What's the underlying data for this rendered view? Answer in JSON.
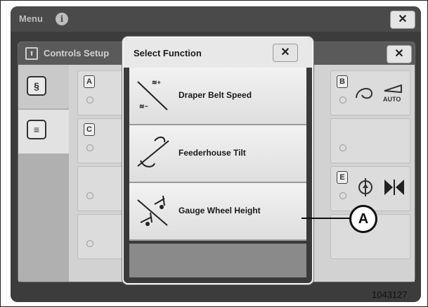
{
  "menu": {
    "title": "Menu",
    "info_glyph": "i",
    "close_glyph": "✕"
  },
  "panel": {
    "title": "Controls Setup",
    "close_glyph": "✕"
  },
  "grid": {
    "letters": [
      "A",
      "B",
      "C",
      "E"
    ],
    "auto_label": "AUTO"
  },
  "modal": {
    "title": "Select Function",
    "close_glyph": "✕",
    "items": [
      {
        "label": "Draper Belt Speed",
        "icon": "draper-belt-speed-icon"
      },
      {
        "label": "Feederhouse Tilt",
        "icon": "feederhouse-tilt-icon"
      },
      {
        "label": "Gauge Wheel Height",
        "icon": "gauge-wheel-height-icon"
      }
    ]
  },
  "callout": {
    "label": "A"
  },
  "figure_number": "1043127"
}
